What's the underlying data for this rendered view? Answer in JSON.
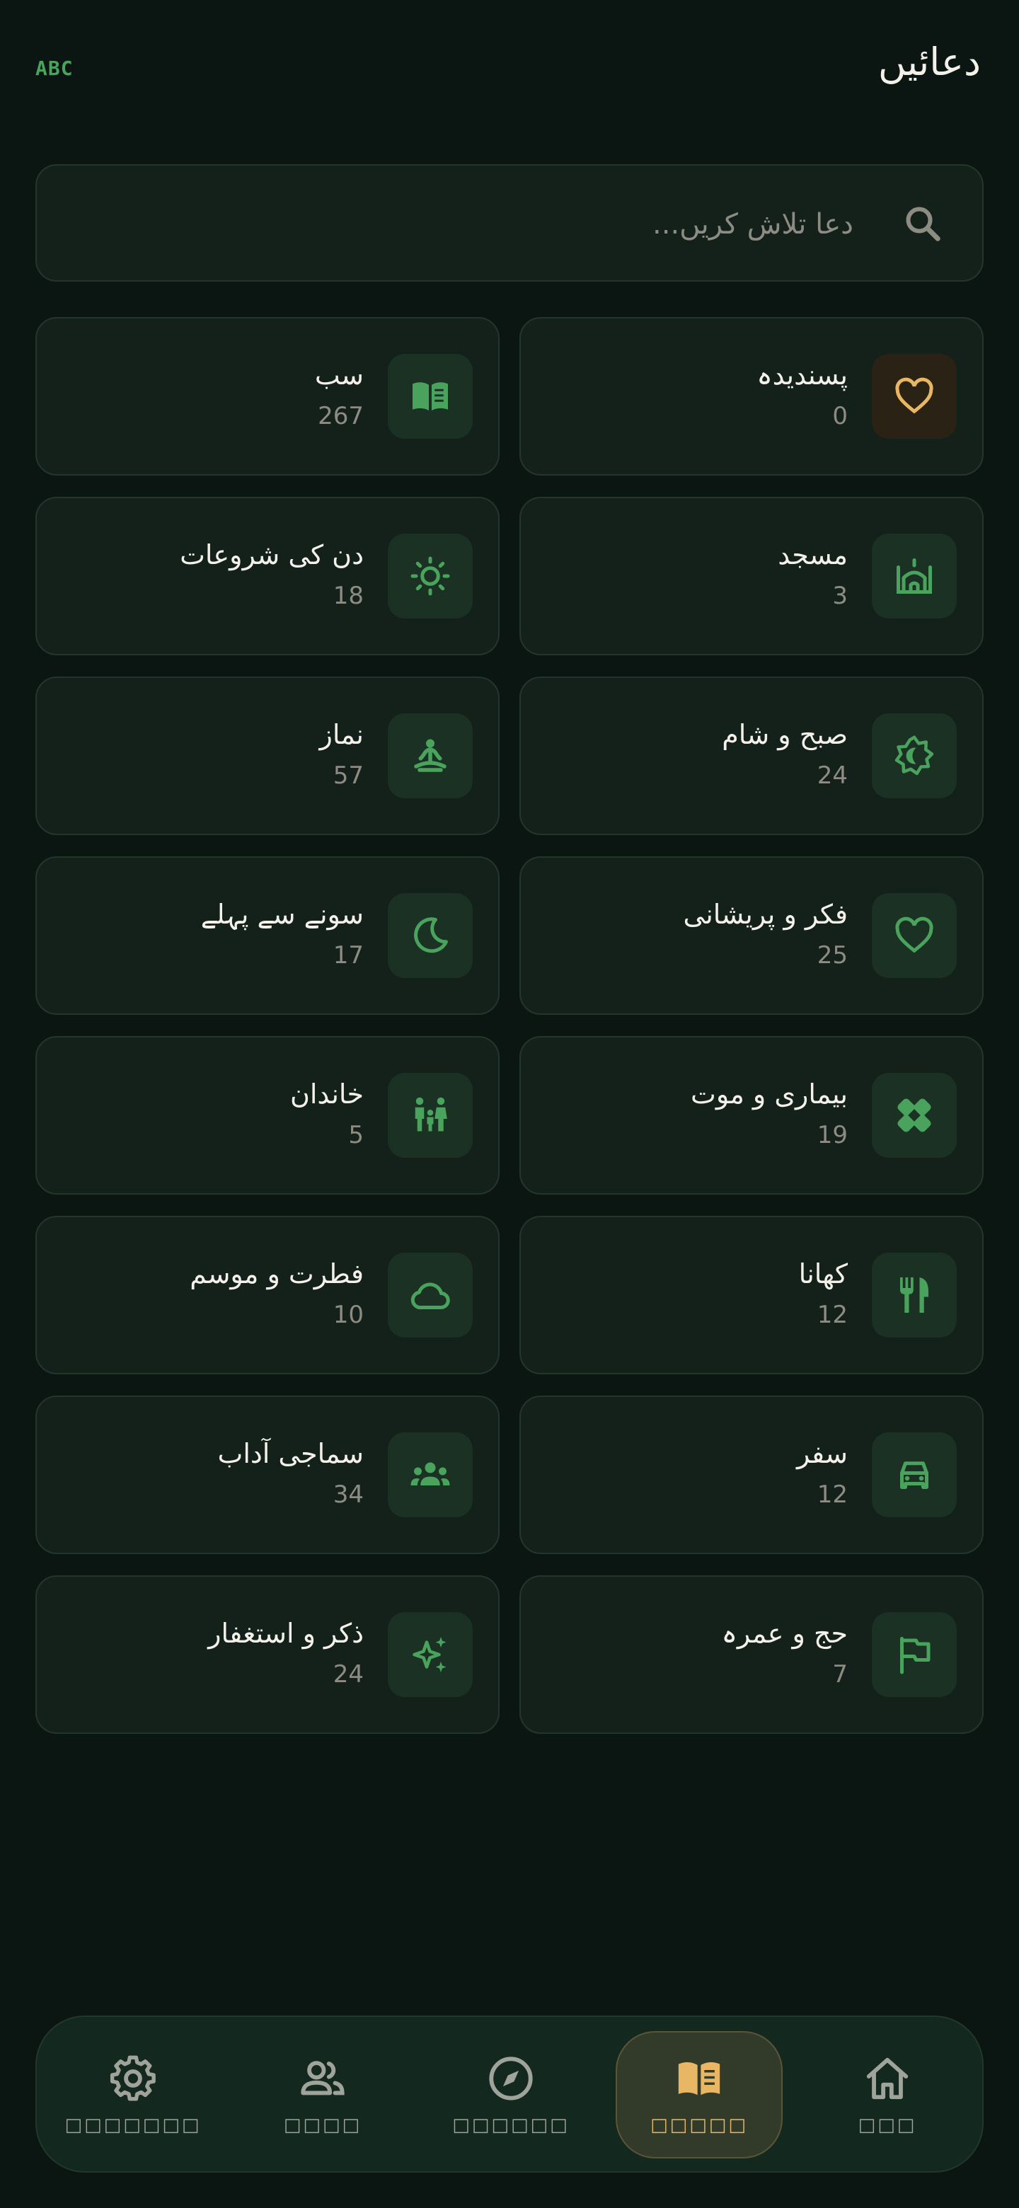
{
  "header": {
    "abc_label": "ABC",
    "title": "دعائیں"
  },
  "search": {
    "placeholder": "دعا تلاش کریں..."
  },
  "categories": [
    {
      "label": "سب",
      "count": "267",
      "icon": "book-icon"
    },
    {
      "label": "پسندیدہ",
      "count": "0",
      "icon": "heart-outline-icon"
    },
    {
      "label": "دن کی شروعات",
      "count": "18",
      "icon": "sun-icon"
    },
    {
      "label": "مسجد",
      "count": "3",
      "icon": "mosque-icon"
    },
    {
      "label": "نماز",
      "count": "57",
      "icon": "prayer-icon"
    },
    {
      "label": "صبح و شام",
      "count": "24",
      "icon": "sun-moon-icon"
    },
    {
      "label": "سونے سے پہلے",
      "count": "17",
      "icon": "moon-icon"
    },
    {
      "label": "فکر و پریشانی",
      "count": "25",
      "icon": "heart-icon"
    },
    {
      "label": "خاندان",
      "count": "5",
      "icon": "family-icon"
    },
    {
      "label": "بیماری و موت",
      "count": "19",
      "icon": "bandage-icon"
    },
    {
      "label": "فطرت و موسم",
      "count": "10",
      "icon": "cloud-icon"
    },
    {
      "label": "کھانا",
      "count": "12",
      "icon": "utensils-icon"
    },
    {
      "label": "سماجی آداب",
      "count": "34",
      "icon": "group-icon"
    },
    {
      "label": "سفر",
      "count": "12",
      "icon": "car-icon"
    },
    {
      "label": "ذکر و استغفار",
      "count": "24",
      "icon": "sparkle-icon"
    },
    {
      "label": "حج و عمرہ",
      "count": "7",
      "icon": "flag-icon"
    }
  ],
  "nav": [
    {
      "label": "□□□□□□□",
      "icon": "gear-icon",
      "active": false
    },
    {
      "label": "□□□□",
      "icon": "people-icon",
      "active": false
    },
    {
      "label": "□□□□□□",
      "icon": "compass-icon",
      "active": false
    },
    {
      "label": "□□□□□",
      "icon": "book-icon",
      "active": true
    },
    {
      "label": "□□□",
      "icon": "home-icon",
      "active": false
    }
  ],
  "colors": {
    "accent_green": "#4aa35d",
    "accent_gold": "#e7b765",
    "background": "#0b1512",
    "card": "#14211b"
  }
}
